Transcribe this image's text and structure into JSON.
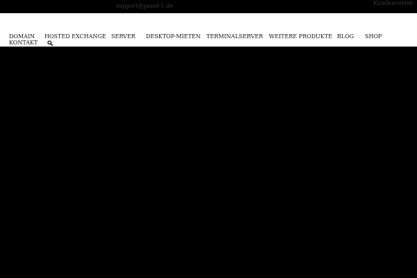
{
  "topbar": {
    "email": "support@panel-1.de",
    "kundencenter": "Kundencenter"
  },
  "nav": {
    "items": [
      {
        "label": "DOMAIN"
      },
      {
        "label": "HOSTED EXCHANGE"
      },
      {
        "label": "SERVER"
      },
      {
        "label": "DESKTOP-MIETEN"
      },
      {
        "label": "TERMINALSERVER"
      },
      {
        "label": "WEITERE PRODUKTE"
      },
      {
        "label": "BLOG"
      },
      {
        "label": "SHOP"
      },
      {
        "label": "KONTAKT"
      }
    ],
    "search_icon": "search-icon"
  },
  "colors": {
    "background": "#000000",
    "navbar_background": "#ffffff",
    "nav_text": "#111111",
    "topbar_text": "#3a3a3a"
  }
}
